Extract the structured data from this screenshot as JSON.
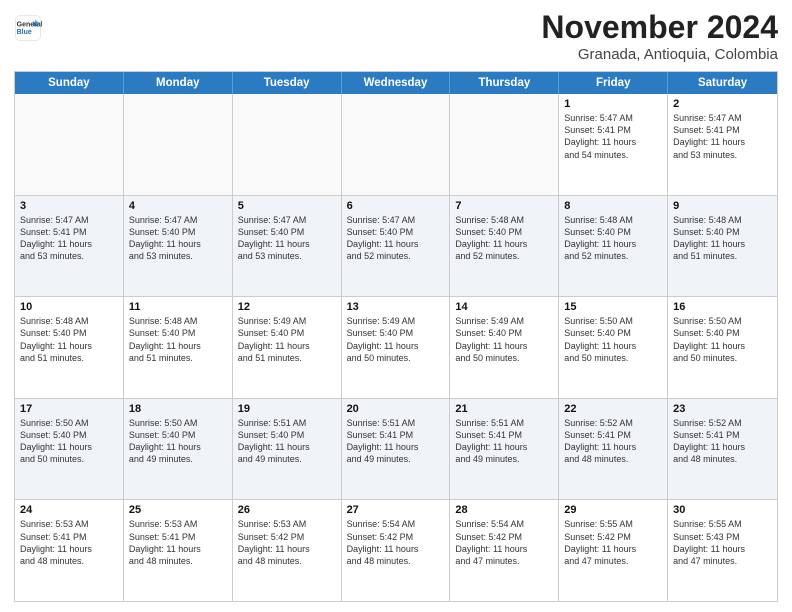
{
  "header": {
    "logo_line1": "General",
    "logo_line2": "Blue",
    "month": "November 2024",
    "location": "Granada, Antioquia, Colombia"
  },
  "days_of_week": [
    "Sunday",
    "Monday",
    "Tuesday",
    "Wednesday",
    "Thursday",
    "Friday",
    "Saturday"
  ],
  "weeks": [
    [
      {
        "day": "",
        "info": ""
      },
      {
        "day": "",
        "info": ""
      },
      {
        "day": "",
        "info": ""
      },
      {
        "day": "",
        "info": ""
      },
      {
        "day": "",
        "info": ""
      },
      {
        "day": "1",
        "info": "Sunrise: 5:47 AM\nSunset: 5:41 PM\nDaylight: 11 hours\nand 54 minutes."
      },
      {
        "day": "2",
        "info": "Sunrise: 5:47 AM\nSunset: 5:41 PM\nDaylight: 11 hours\nand 53 minutes."
      }
    ],
    [
      {
        "day": "3",
        "info": "Sunrise: 5:47 AM\nSunset: 5:41 PM\nDaylight: 11 hours\nand 53 minutes."
      },
      {
        "day": "4",
        "info": "Sunrise: 5:47 AM\nSunset: 5:40 PM\nDaylight: 11 hours\nand 53 minutes."
      },
      {
        "day": "5",
        "info": "Sunrise: 5:47 AM\nSunset: 5:40 PM\nDaylight: 11 hours\nand 53 minutes."
      },
      {
        "day": "6",
        "info": "Sunrise: 5:47 AM\nSunset: 5:40 PM\nDaylight: 11 hours\nand 52 minutes."
      },
      {
        "day": "7",
        "info": "Sunrise: 5:48 AM\nSunset: 5:40 PM\nDaylight: 11 hours\nand 52 minutes."
      },
      {
        "day": "8",
        "info": "Sunrise: 5:48 AM\nSunset: 5:40 PM\nDaylight: 11 hours\nand 52 minutes."
      },
      {
        "day": "9",
        "info": "Sunrise: 5:48 AM\nSunset: 5:40 PM\nDaylight: 11 hours\nand 51 minutes."
      }
    ],
    [
      {
        "day": "10",
        "info": "Sunrise: 5:48 AM\nSunset: 5:40 PM\nDaylight: 11 hours\nand 51 minutes."
      },
      {
        "day": "11",
        "info": "Sunrise: 5:48 AM\nSunset: 5:40 PM\nDaylight: 11 hours\nand 51 minutes."
      },
      {
        "day": "12",
        "info": "Sunrise: 5:49 AM\nSunset: 5:40 PM\nDaylight: 11 hours\nand 51 minutes."
      },
      {
        "day": "13",
        "info": "Sunrise: 5:49 AM\nSunset: 5:40 PM\nDaylight: 11 hours\nand 50 minutes."
      },
      {
        "day": "14",
        "info": "Sunrise: 5:49 AM\nSunset: 5:40 PM\nDaylight: 11 hours\nand 50 minutes."
      },
      {
        "day": "15",
        "info": "Sunrise: 5:50 AM\nSunset: 5:40 PM\nDaylight: 11 hours\nand 50 minutes."
      },
      {
        "day": "16",
        "info": "Sunrise: 5:50 AM\nSunset: 5:40 PM\nDaylight: 11 hours\nand 50 minutes."
      }
    ],
    [
      {
        "day": "17",
        "info": "Sunrise: 5:50 AM\nSunset: 5:40 PM\nDaylight: 11 hours\nand 50 minutes."
      },
      {
        "day": "18",
        "info": "Sunrise: 5:50 AM\nSunset: 5:40 PM\nDaylight: 11 hours\nand 49 minutes."
      },
      {
        "day": "19",
        "info": "Sunrise: 5:51 AM\nSunset: 5:40 PM\nDaylight: 11 hours\nand 49 minutes."
      },
      {
        "day": "20",
        "info": "Sunrise: 5:51 AM\nSunset: 5:41 PM\nDaylight: 11 hours\nand 49 minutes."
      },
      {
        "day": "21",
        "info": "Sunrise: 5:51 AM\nSunset: 5:41 PM\nDaylight: 11 hours\nand 49 minutes."
      },
      {
        "day": "22",
        "info": "Sunrise: 5:52 AM\nSunset: 5:41 PM\nDaylight: 11 hours\nand 48 minutes."
      },
      {
        "day": "23",
        "info": "Sunrise: 5:52 AM\nSunset: 5:41 PM\nDaylight: 11 hours\nand 48 minutes."
      }
    ],
    [
      {
        "day": "24",
        "info": "Sunrise: 5:53 AM\nSunset: 5:41 PM\nDaylight: 11 hours\nand 48 minutes."
      },
      {
        "day": "25",
        "info": "Sunrise: 5:53 AM\nSunset: 5:41 PM\nDaylight: 11 hours\nand 48 minutes."
      },
      {
        "day": "26",
        "info": "Sunrise: 5:53 AM\nSunset: 5:42 PM\nDaylight: 11 hours\nand 48 minutes."
      },
      {
        "day": "27",
        "info": "Sunrise: 5:54 AM\nSunset: 5:42 PM\nDaylight: 11 hours\nand 48 minutes."
      },
      {
        "day": "28",
        "info": "Sunrise: 5:54 AM\nSunset: 5:42 PM\nDaylight: 11 hours\nand 47 minutes."
      },
      {
        "day": "29",
        "info": "Sunrise: 5:55 AM\nSunset: 5:42 PM\nDaylight: 11 hours\nand 47 minutes."
      },
      {
        "day": "30",
        "info": "Sunrise: 5:55 AM\nSunset: 5:43 PM\nDaylight: 11 hours\nand 47 minutes."
      }
    ]
  ]
}
